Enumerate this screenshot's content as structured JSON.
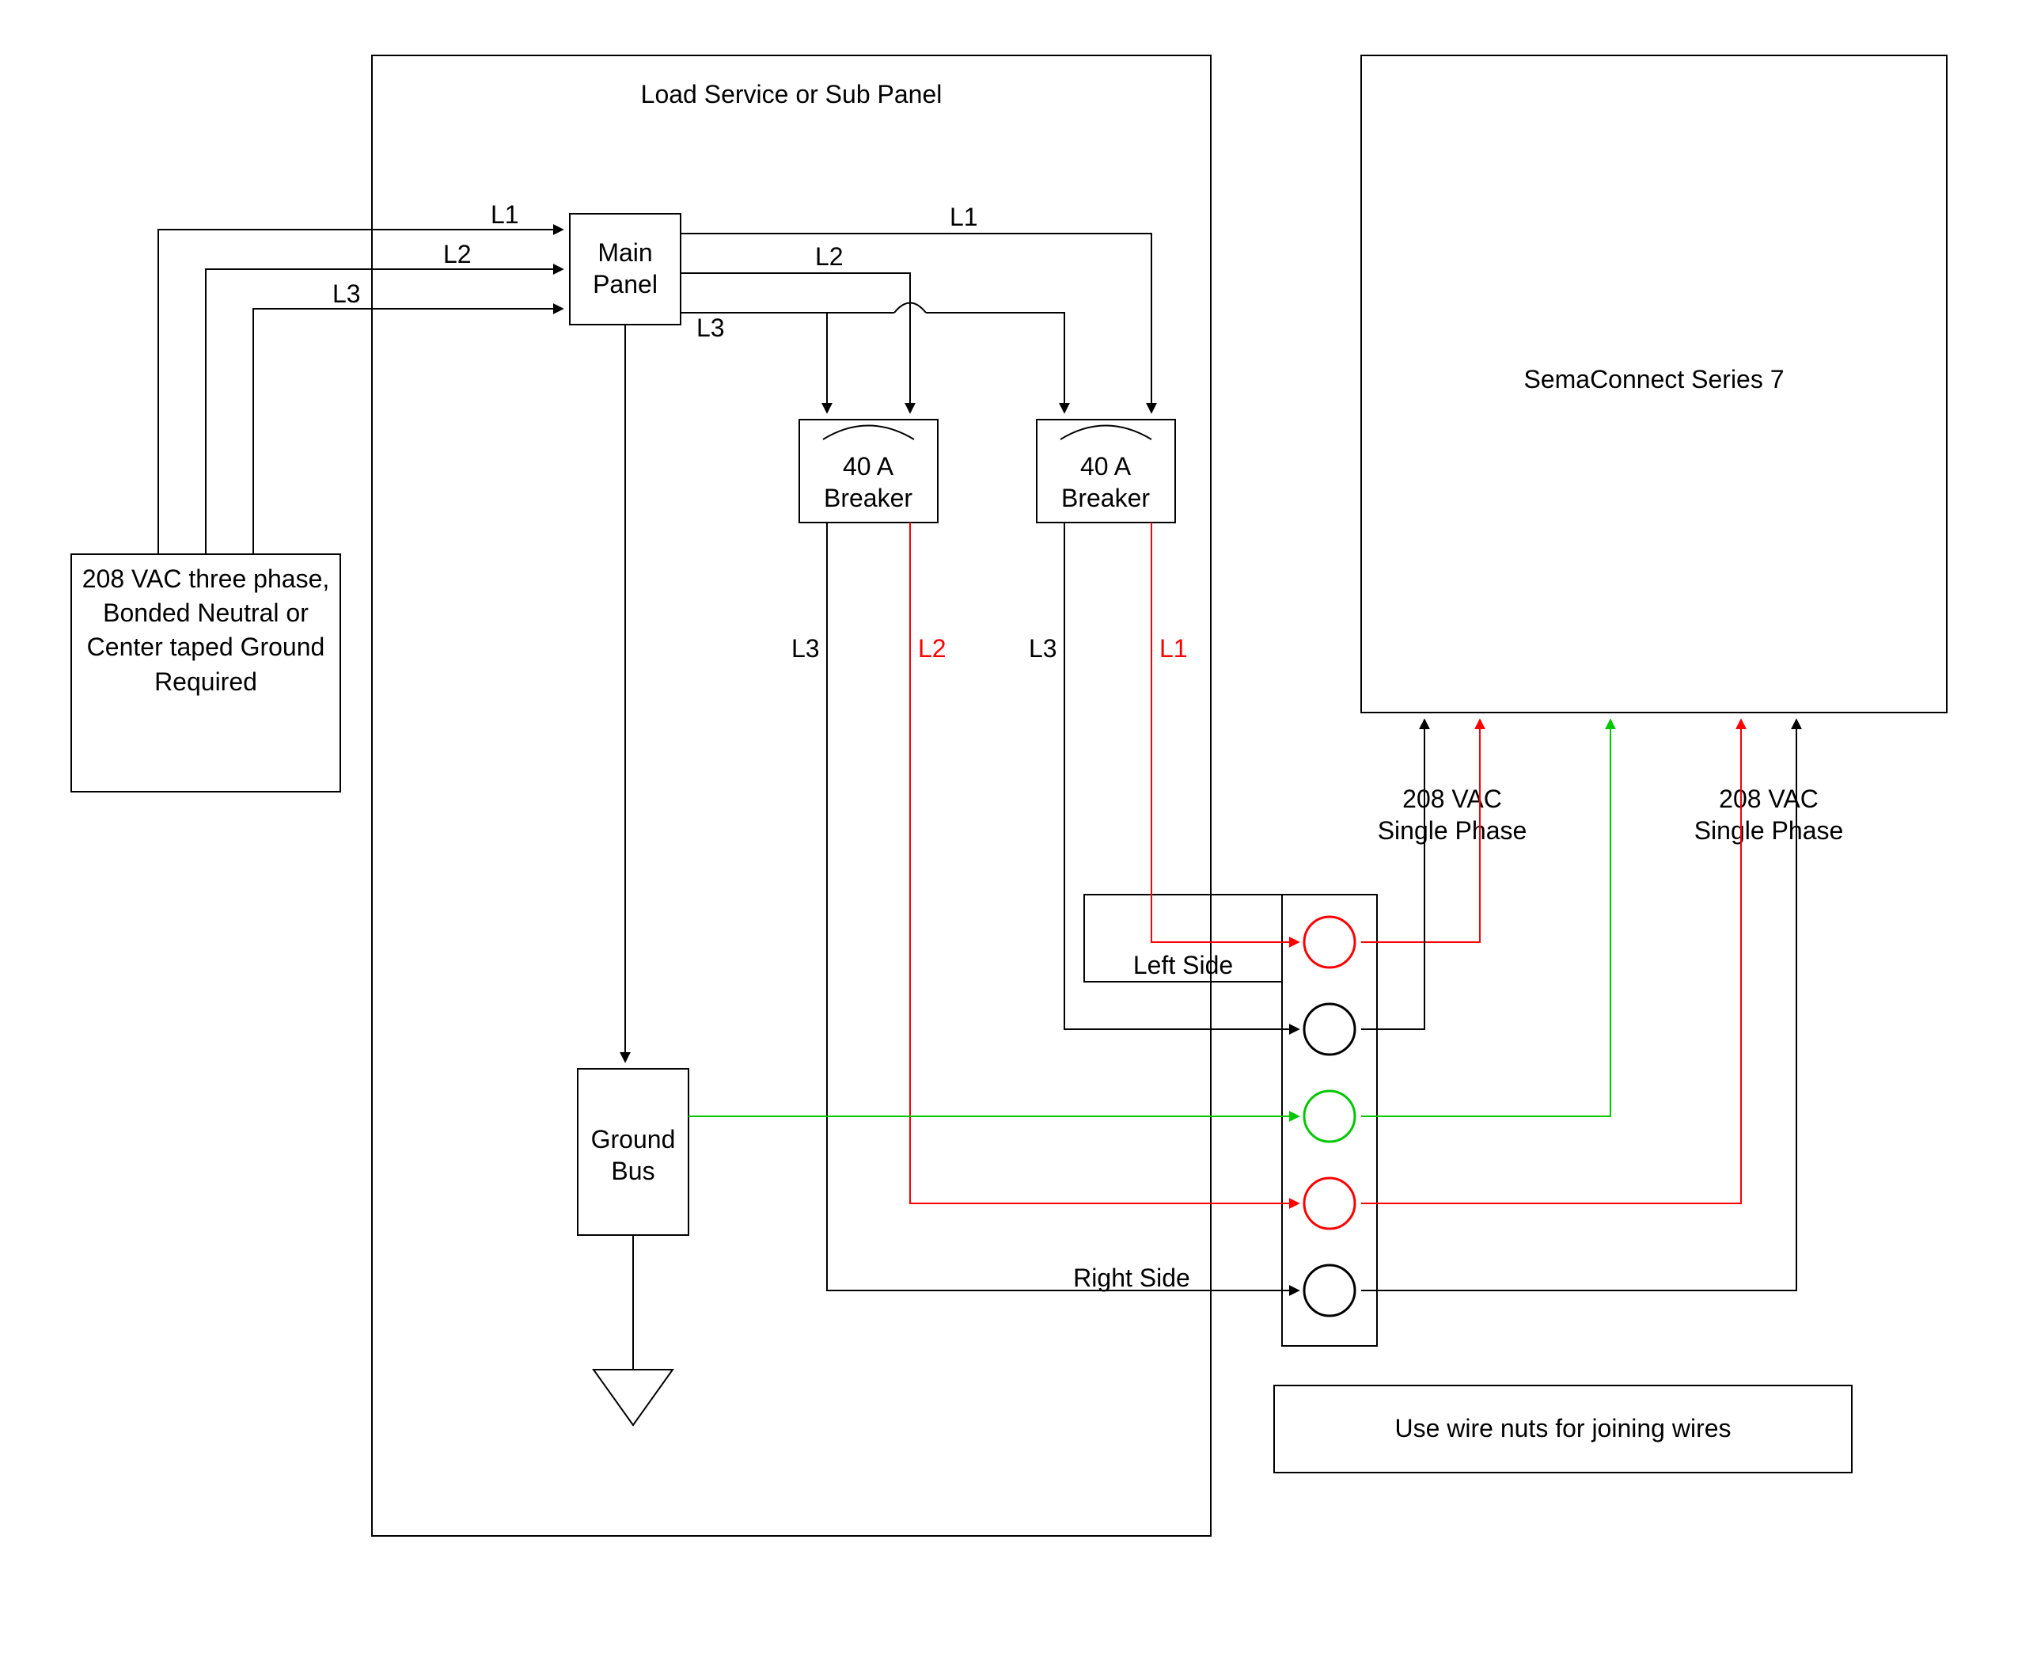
{
  "panel_title": "Load Service or Sub Panel",
  "source_box": "208 VAC three phase, Bonded Neutral or Center taped Ground Required",
  "main_panel": "Main Panel",
  "breaker_label_line1": "40 A",
  "breaker_label_line2": "Breaker",
  "ground_bus_line1": "Ground",
  "ground_bus_line2": "Bus",
  "phases": {
    "L1": "L1",
    "L2": "L2",
    "L3": "L3"
  },
  "left_side": "Left Side",
  "right_side": "Right Side",
  "sema_title": "SemaConnect Series 7",
  "single_phase_line1": "208 VAC",
  "single_phase_line2": "Single Phase",
  "footer_note": "Use wire nuts for joining wires",
  "colors": {
    "black": "#000000",
    "red": "#ff0000",
    "green": "#00c800"
  }
}
